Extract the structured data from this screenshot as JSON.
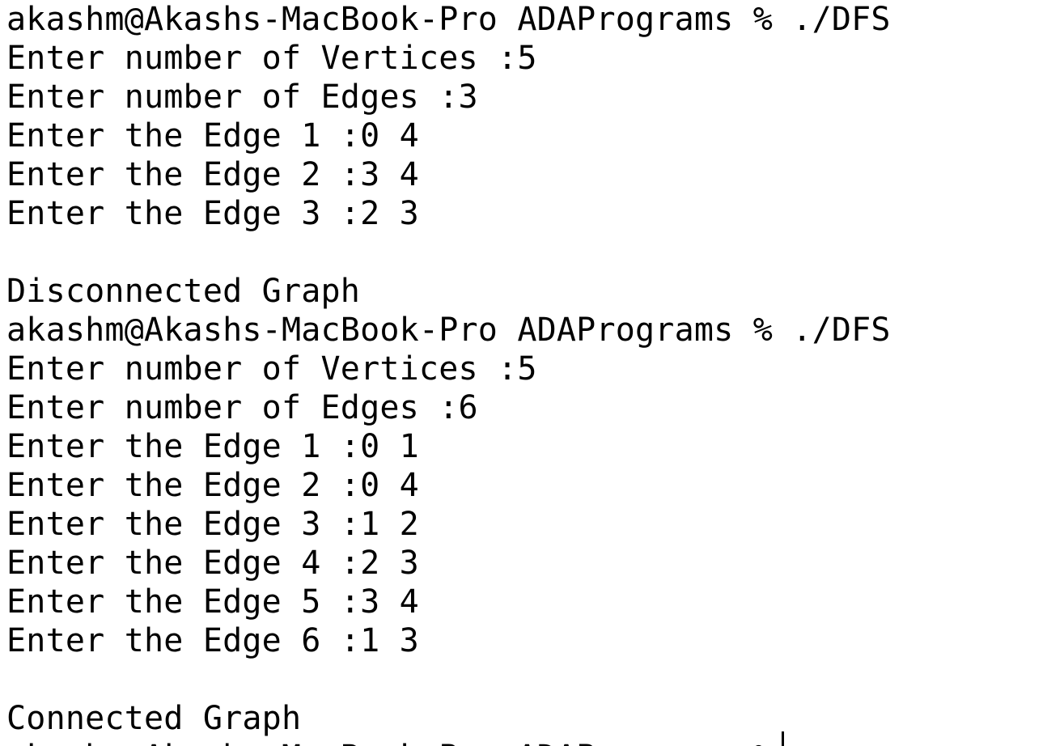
{
  "terminal": {
    "lines": [
      "akashm@Akashs-MacBook-Pro ADAPrograms % ./DFS",
      "Enter number of Vertices :5",
      "Enter number of Edges :3",
      "Enter the Edge 1 :0 4",
      "Enter the Edge 2 :3 4",
      "Enter the Edge 3 :2 3",
      "",
      "Disconnected Graph",
      "akashm@Akashs-MacBook-Pro ADAPrograms % ./DFS",
      "Enter number of Vertices :5",
      "Enter number of Edges :6",
      "Enter the Edge 1 :0 1",
      "Enter the Edge 2 :0 4",
      "Enter the Edge 3 :1 2",
      "Enter the Edge 4 :2 3",
      "Enter the Edge 5 :3 4",
      "Enter the Edge 6 :1 3",
      "",
      "Connected Graph",
      "akashm@Akashs-MacBook-Pro ADAPrograms % "
    ]
  }
}
